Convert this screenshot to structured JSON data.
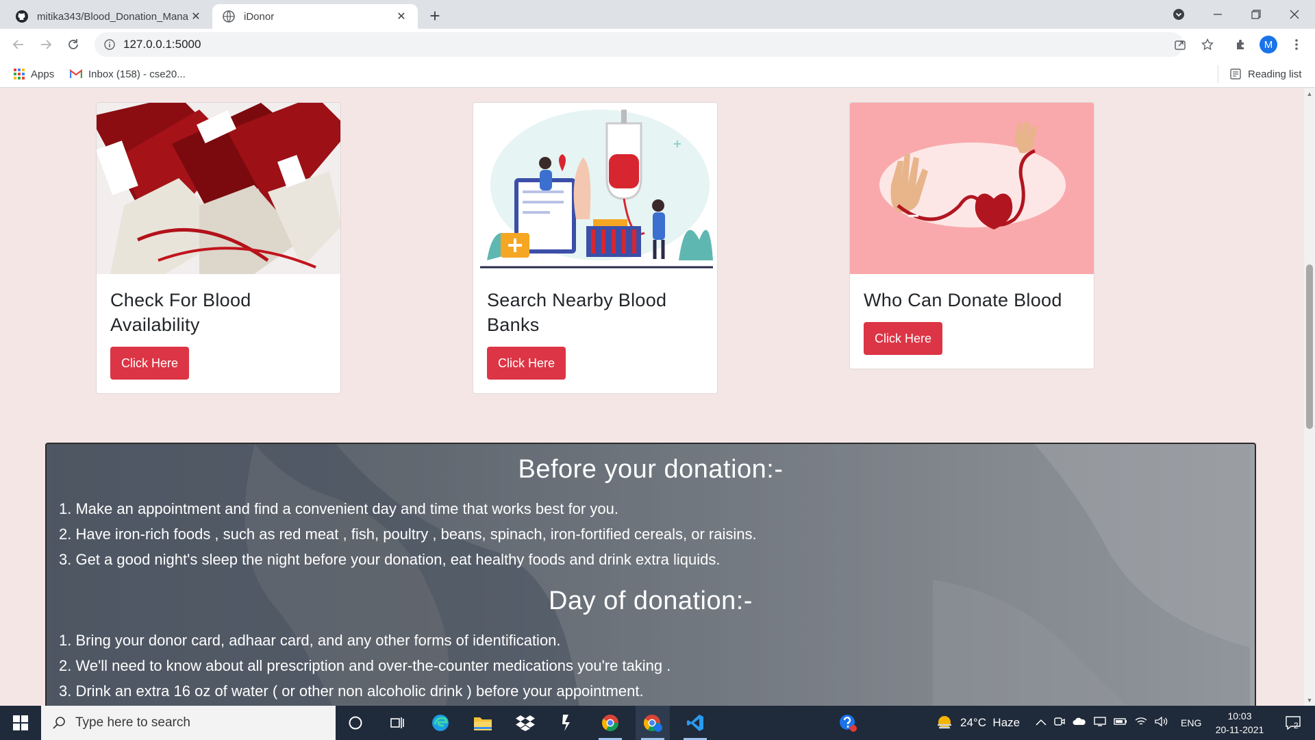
{
  "browser": {
    "tabs": [
      {
        "title": "mitika343/Blood_Donation_Mana",
        "close": "✕"
      },
      {
        "title": "iDonor",
        "close": "✕"
      }
    ],
    "new_tab": "+",
    "url": "127.0.0.1:5000",
    "profile_initial": "M",
    "bookmarks": [
      {
        "label": "Apps"
      },
      {
        "label": "Inbox (158) - cse20..."
      }
    ],
    "reading_list": "Reading list"
  },
  "cards": [
    {
      "title": "Check For Blood Availability",
      "button": "Click Here"
    },
    {
      "title": "Search Nearby Blood Banks",
      "button": "Click Here"
    },
    {
      "title": "Who Can Donate Blood",
      "button": "Click Here"
    }
  ],
  "info": {
    "before_title": "Before your donation:-",
    "before_items": [
      "1. Make an appointment and find a convenient day and time that works best for you.",
      "2. Have iron-rich foods , such as red meat , fish, poultry , beans, spinach, iron-fortified cereals, or raisins.",
      "3. Get a good night's sleep the night before your donation, eat healthy foods and drink extra liquids."
    ],
    "day_title": "Day of donation:-",
    "day_items": [
      "1. Bring your donor card, adhaar card, and any other forms of identification.",
      "2. We'll need to know about all prescription and over-the-counter medications you're taking .",
      "3. Drink an extra 16 oz of water ( or other non alcoholic drink ) before your appointment."
    ]
  },
  "taskbar": {
    "search_placeholder": "Type here to search",
    "weather": "24°C  Haze",
    "language": "ENG",
    "time": "10:03",
    "date": "20-11-2021",
    "notifications": "2"
  },
  "colors": {
    "accent_button": "#dc3545",
    "page_background": "#f5e6e6",
    "taskbar": "#1f2a3a"
  }
}
